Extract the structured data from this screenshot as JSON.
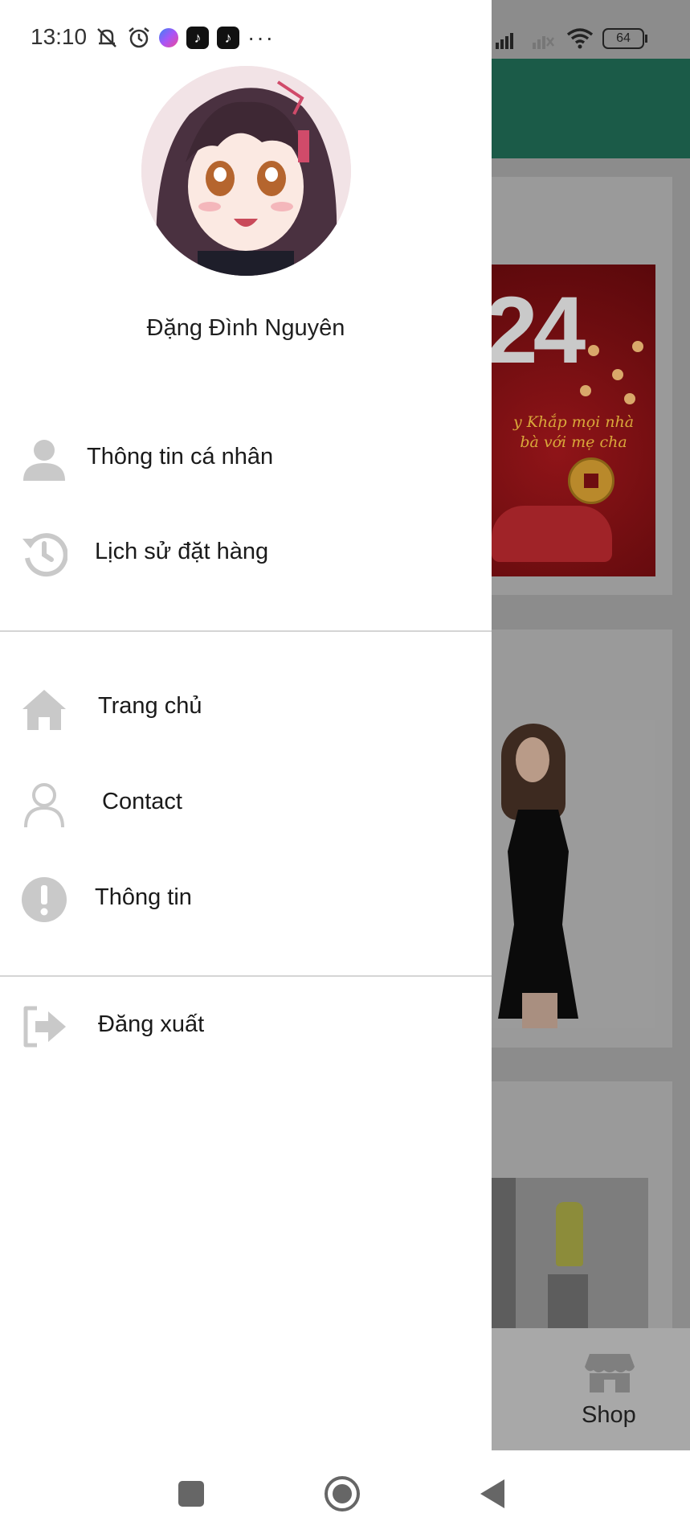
{
  "status_bar": {
    "time": "13:10",
    "battery": "64",
    "left_icons": [
      "mute-bell-icon",
      "alarm-icon",
      "messenger-icon",
      "tiktok-icon",
      "tiktok-icon",
      "more-icon"
    ],
    "right_icons": [
      "signal-icon",
      "signal-off-icon",
      "wifi-icon",
      "battery-icon"
    ]
  },
  "drawer": {
    "user_name": "Đặng Đình Nguyên",
    "section_account": [
      {
        "label": "Thông tin cá nhân",
        "icon": "person-icon"
      },
      {
        "label": "Lịch sử đặt hàng",
        "icon": "history-icon"
      }
    ],
    "section_nav": [
      {
        "label": "Trang chủ",
        "icon": "home-icon"
      },
      {
        "label": "Contact",
        "icon": "contact-icon"
      },
      {
        "label": "Thông tin",
        "icon": "info-icon"
      }
    ],
    "logout": {
      "label": "Đăng xuất",
      "icon": "logout-icon"
    }
  },
  "background": {
    "banner_year": "24",
    "banner_text": "y Khắp mọi nhà\nbà với mẹ cha",
    "shop_label": "Shop"
  },
  "colors": {
    "header": "#1b5b48",
    "overlay": "#8c8c8c",
    "icon": "#c9c9c9"
  }
}
